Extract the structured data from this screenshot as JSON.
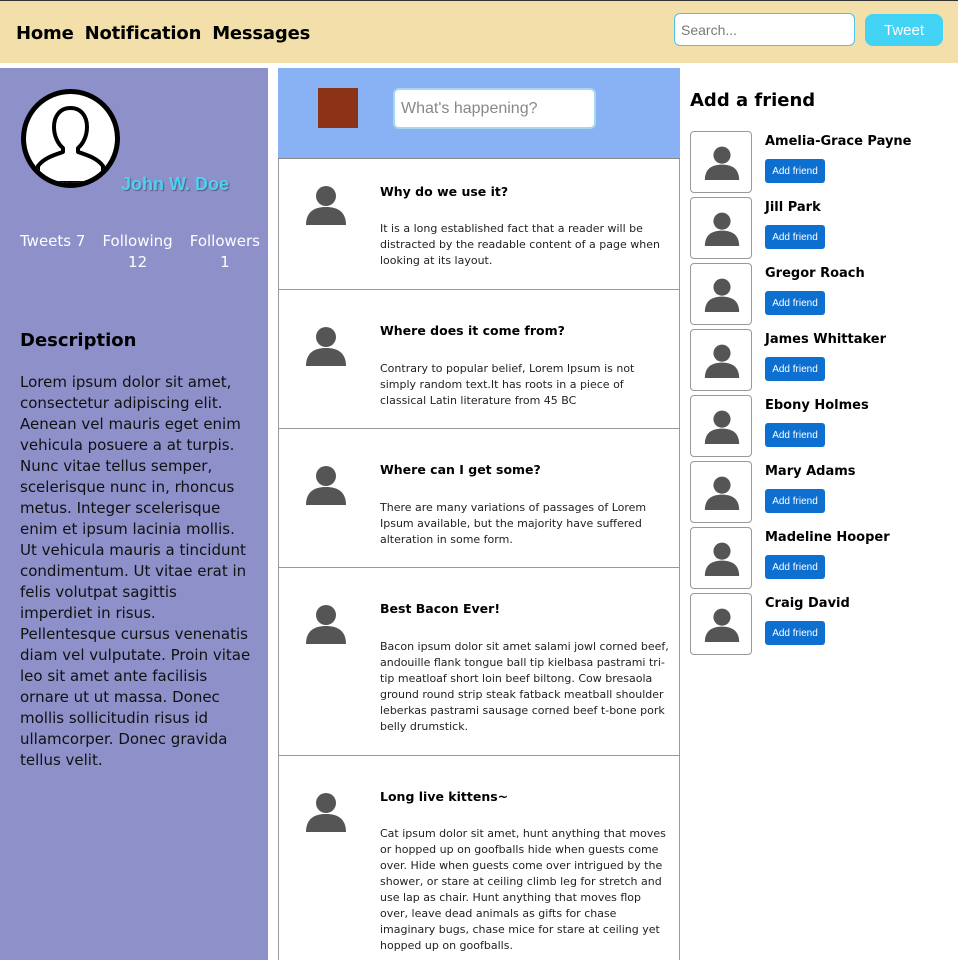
{
  "header": {
    "nav": [
      "Home",
      "Notification",
      "Messages"
    ],
    "search_placeholder": "Search...",
    "tweet_label": "Tweet"
  },
  "profile": {
    "name": "John W. Doe",
    "stats": [
      {
        "label": "Tweets 7",
        "num": ""
      },
      {
        "label": "Following",
        "num": "12"
      },
      {
        "label": "Followers",
        "num": "1"
      }
    ],
    "description_title": "Description",
    "description": "Lorem ipsum dolor sit amet, consectetur adipiscing elit. Aenean vel mauris eget enim vehicula posuere a at turpis. Nunc vitae tellus semper, scelerisque nunc in, rhoncus metus. Integer scelerisque enim et ipsum lacinia mollis. Ut vehicula mauris a tincidunt condimentum. Ut vitae erat in felis volutpat sagittis imperdiet in risus. Pellentesque cursus venenatis diam vel vulputate. Proin vitae leo sit amet ante facilisis ornare ut ut massa. Donec mollis sollicitudin risus id ullamcorper. Donec gravida tellus velit."
  },
  "compose": {
    "placeholder": "What's happening?"
  },
  "feed": [
    {
      "title": "Why do we use it?",
      "text": "It is a long established fact that a reader will be distracted by the readable content of a page when looking at its layout."
    },
    {
      "title": "Where does it come from?",
      "text": "Contrary to popular belief, Lorem Ipsum is not simply random text.It has roots in a piece of classical Latin literature from 45 BC"
    },
    {
      "title": "Where can I get some?",
      "text": "There are many variations of passages of Lorem Ipsum available, but the majority have suffered alteration in some form."
    },
    {
      "title": "Best Bacon Ever!",
      "text": "Bacon ipsum dolor sit amet salami jowl corned beef, andouille flank tongue ball tip kielbasa pastrami tri-tip meatloaf short loin beef biltong. Cow bresaola ground round strip steak fatback meatball shoulder leberkas pastrami sausage corned beef t-bone pork belly drumstick."
    },
    {
      "title": "Long live kittens~",
      "text": "Cat ipsum dolor sit amet, hunt anything that moves or hopped up on goofballs hide when guests come over. Hide when guests come over intrigued by the shower, or stare at ceiling climb leg for stretch and use lap as chair. Hunt anything that moves flop over, leave dead animals as gifts for chase imaginary bugs, chase mice for stare at ceiling yet hopped up on goofballs."
    }
  ],
  "friends": {
    "title": "Add a friend",
    "button_label": "Add friend",
    "people": [
      "Amelia-Grace Payne",
      "Jill Park",
      "Gregor Roach",
      "James Whittaker",
      "Ebony Holmes",
      "Mary Adams",
      "Madeline Hooper",
      "Craig David"
    ]
  },
  "colors": {
    "header_bg": "#f2dfa9",
    "profile_bg": "#8d90c9",
    "compose_bg": "#89b2f5",
    "tweet_button": "#43d3f5",
    "add_friend_button": "#0d6fcf",
    "profile_name": "#4fd0f0"
  },
  "icons": {
    "profile_avatar": "user-outline-icon",
    "feed_avatar": "user-silhouette-icon",
    "friend_avatar": "user-silhouette-icon"
  }
}
